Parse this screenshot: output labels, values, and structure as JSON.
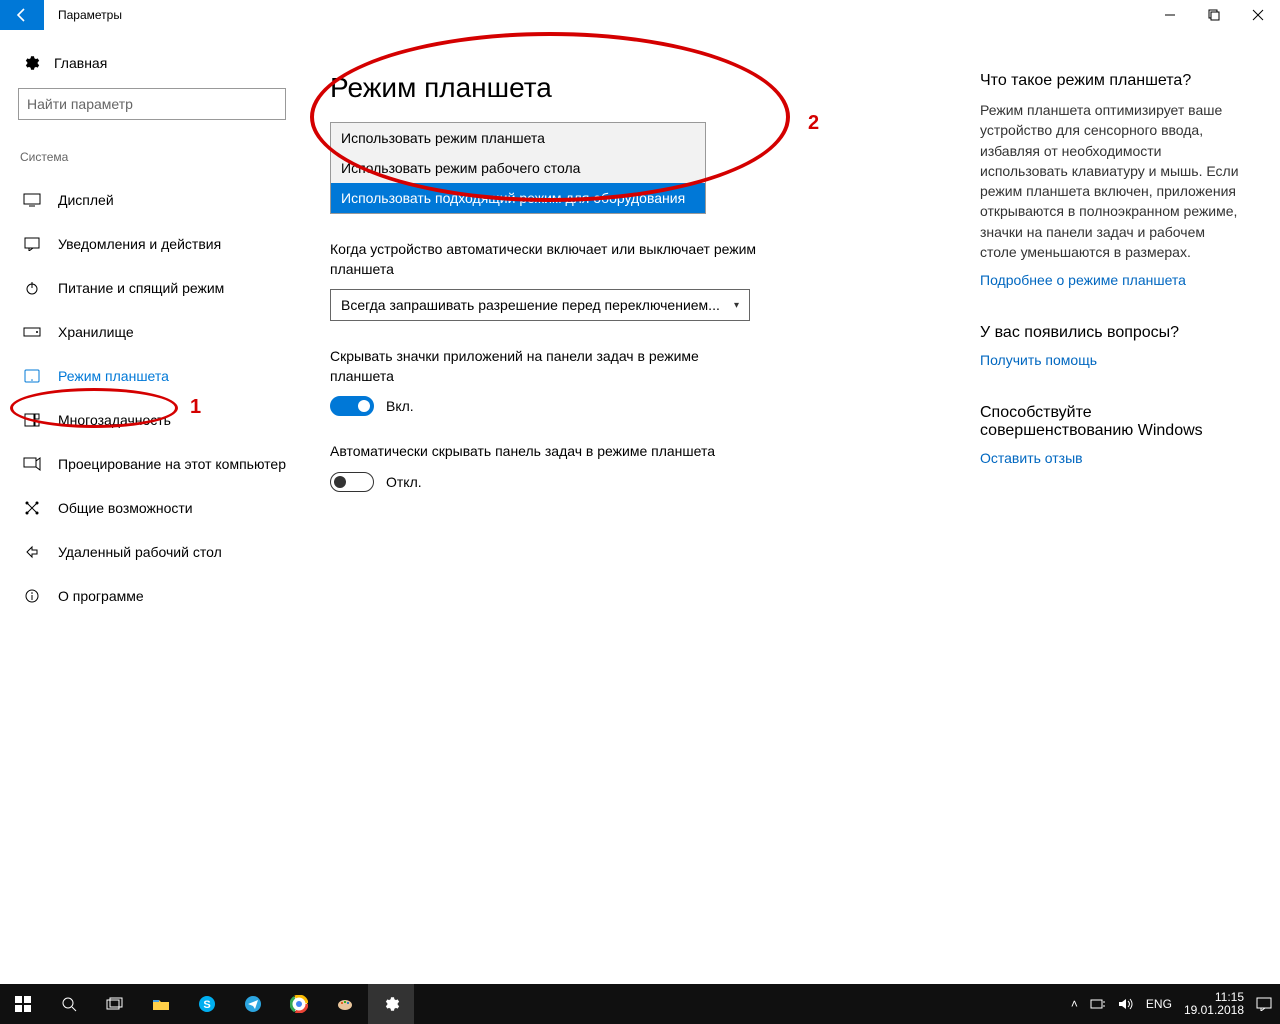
{
  "titlebar": {
    "title": "Параметры"
  },
  "sidebar": {
    "home": "Главная",
    "search_placeholder": "Найти параметр",
    "category": "Система",
    "items": [
      {
        "label": "Дисплей"
      },
      {
        "label": "Уведомления и действия"
      },
      {
        "label": "Питание и спящий режим"
      },
      {
        "label": "Хранилище"
      },
      {
        "label": "Режим планшета"
      },
      {
        "label": "Многозадачность"
      },
      {
        "label": "Проецирование на этот компьютер"
      },
      {
        "label": "Общие возможности"
      },
      {
        "label": "Удаленный рабочий стол"
      },
      {
        "label": "О программе"
      }
    ]
  },
  "page": {
    "title": "Режим планшета",
    "dropdown1": {
      "opt0": "Использовать режим планшета",
      "opt1": "Использовать режим рабочего стола",
      "opt2": "Использовать подходящий режим для оборудования"
    },
    "label2": "Когда устройство автоматически включает или выключает режим планшета",
    "combo2": "Всегда запрашивать разрешение перед переключением...",
    "label3": "Скрывать значки приложений на панели задач в режиме планшета",
    "toggle_on": "Вкл.",
    "label4": "Автоматически скрывать панель задач в режиме планшета",
    "toggle_off": "Откл."
  },
  "info": {
    "h1": "Что такое режим планшета?",
    "p1": "Режим планшета оптимизирует ваше устройство для сенсорного ввода, избавляя от необходимости использовать клавиатуру и мышь. Если режим планшета включен, приложения открываются в полноэкранном режиме, значки на панели задач и рабочем столе уменьшаются в размерах.",
    "link1": "Подробнее о режиме планшета",
    "h2": "У вас появились вопросы?",
    "link2": "Получить помощь",
    "h3": "Способствуйте совершенствованию Windows",
    "link3": "Оставить отзыв"
  },
  "annotations": {
    "num1": "1",
    "num2": "2"
  },
  "taskbar": {
    "lang": "ENG",
    "time": "11:15",
    "date": "19.01.2018"
  }
}
